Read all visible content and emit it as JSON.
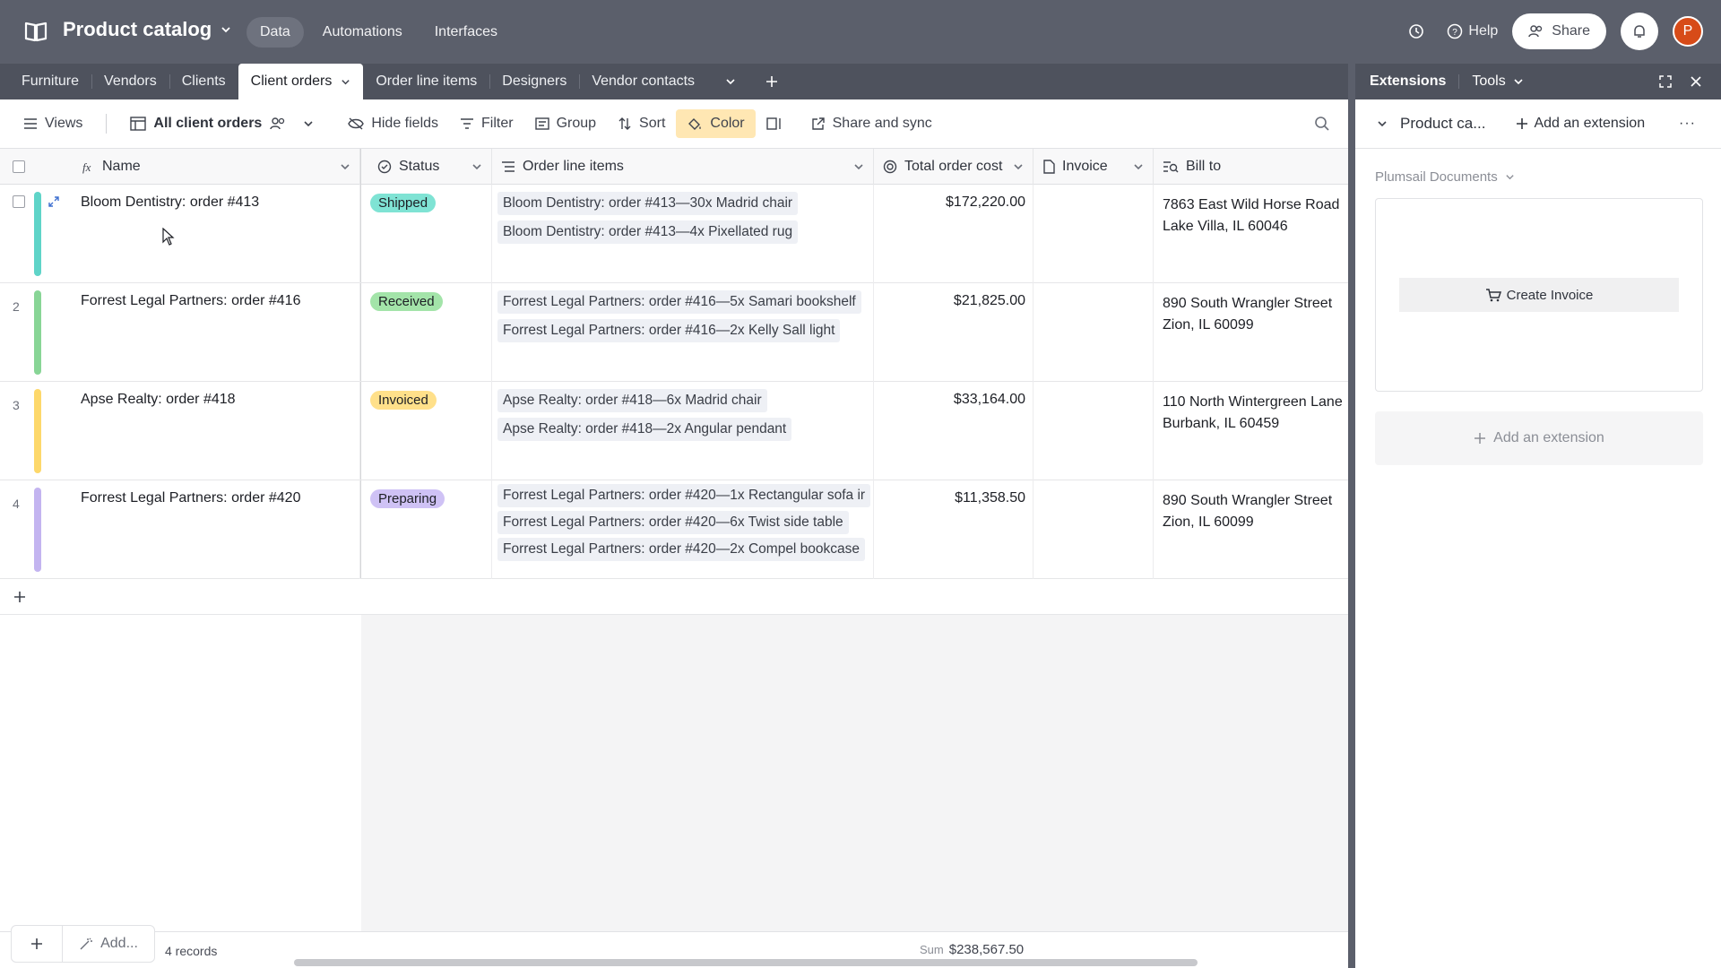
{
  "app": {
    "base_title": "Product catalog",
    "nav": [
      "Data",
      "Automations",
      "Interfaces"
    ],
    "help_label": "Help",
    "share_label": "Share",
    "avatar_initial": "P"
  },
  "tables": [
    "Furniture",
    "Vendors",
    "Clients",
    "Client orders",
    "Order line items",
    "Designers",
    "Vendor contacts"
  ],
  "active_table": "Client orders",
  "viewbar": {
    "views": "Views",
    "view_name": "All client orders",
    "hide_fields": "Hide fields",
    "filter": "Filter",
    "group": "Group",
    "sort": "Sort",
    "color": "Color",
    "share_sync": "Share and sync"
  },
  "columns": [
    "Name",
    "Status",
    "Order line items",
    "Total order cost",
    "Invoice",
    "Bill to"
  ],
  "rows": [
    {
      "num": "",
      "color": "#5fd4c8",
      "name": "Bloom Dentistry: order #413",
      "status": "Shipped",
      "status_bg": "#7fe3d4",
      "lines": [
        "Bloom Dentistry: order #413—30x Madrid chair",
        "Bloom Dentistry: order #413—4x Pixellated rug"
      ],
      "cost": "$172,220.00",
      "bill_1": "7863 East Wild Horse Road",
      "bill_2": "Lake Villa, IL 60046"
    },
    {
      "num": "2",
      "color": "#88d596",
      "name": "Forrest Legal Partners: order #416",
      "status": "Received",
      "status_bg": "#a3e4a9",
      "lines": [
        "Forrest Legal Partners: order #416—5x Samari bookshelf",
        "Forrest Legal Partners: order #416—2x Kelly Sall light"
      ],
      "cost": "$21,825.00",
      "bill_1": "890 South Wrangler Street",
      "bill_2": "Zion, IL 60099"
    },
    {
      "num": "3",
      "color": "#fdd86b",
      "name": "Apse Realty: order #418",
      "status": "Invoiced",
      "status_bg": "#ffe08a",
      "lines": [
        "Apse Realty: order #418—6x Madrid chair",
        "Apse Realty: order #418—2x Angular pendant"
      ],
      "cost": "$33,164.00",
      "bill_1": "110 North Wintergreen Lane",
      "bill_2": "Burbank, IL 60459"
    },
    {
      "num": "4",
      "color": "#c3b4f0",
      "name": "Forrest Legal Partners: order #420",
      "status": "Preparing",
      "status_bg": "#cfc2f5",
      "lines": [
        "Forrest Legal Partners: order #420—1x Rectangular sofa ir",
        "Forrest Legal Partners: order #420—6x Twist side table",
        "Forrest Legal Partners: order #420—2x Compel bookcase"
      ],
      "cost": "$11,358.50",
      "bill_1": "890 South Wrangler Street",
      "bill_2": "Zion, IL 60099"
    }
  ],
  "footer": {
    "add_label": "Add...",
    "records": "4 records",
    "sum_label": "Sum",
    "sum_value": "$238,567.50"
  },
  "extensions": {
    "tab_extensions": "Extensions",
    "tab_tools": "Tools",
    "dashboard_name": "Product ca...",
    "add_extension_top": "Add an extension",
    "extension_name": "Plumsail Documents",
    "create_invoice": "Create Invoice",
    "add_extension_card": "Add an extension"
  }
}
